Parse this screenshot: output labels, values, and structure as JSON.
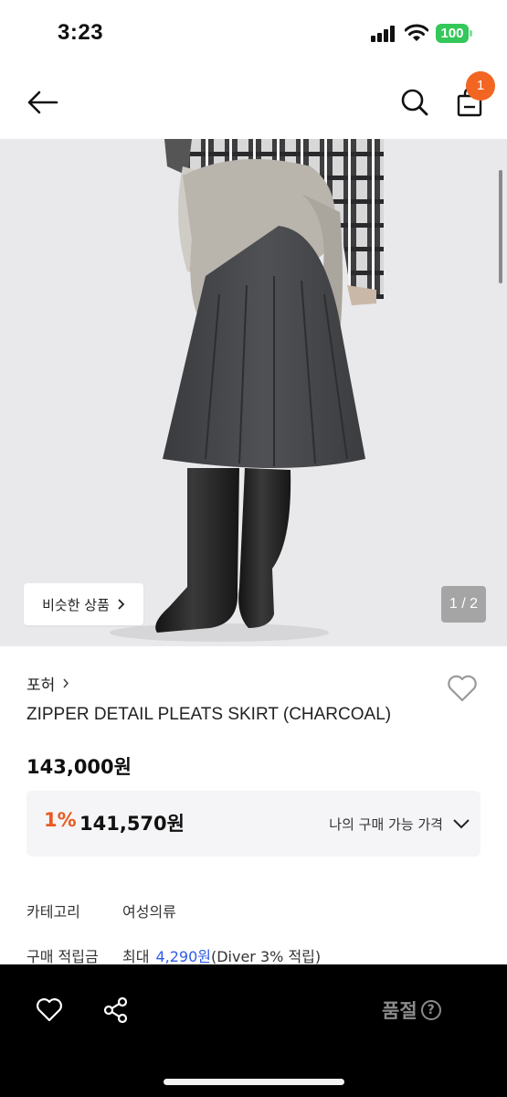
{
  "status_bar": {
    "time": "3:23",
    "battery": "100"
  },
  "nav": {
    "cart_count": "1"
  },
  "hero": {
    "similar_label": "비슷한 상품",
    "page_indicator": "1 / 2"
  },
  "product": {
    "brand": "포허",
    "title": "ZIPPER DETAIL PLEATS SKIRT (CHARCOAL)",
    "price": "143,000원",
    "discount_rate": "1%",
    "discount_price": "141,570원",
    "my_price_label": "나의 구매 가능 가격"
  },
  "info": {
    "category_label": "카테고리",
    "category_value": "여성의류",
    "points_label": "구매 적립금",
    "points_prefix": "최대",
    "points_amount": "4,290원",
    "points_suffix": "(Diver 3% 적립)"
  },
  "bottom_bar": {
    "soldout_label": "품절",
    "help_glyph": "?"
  },
  "colors": {
    "accent": "#ea5a1e",
    "badge": "#f26522",
    "link": "#2f5bea",
    "battery": "#34c759"
  }
}
